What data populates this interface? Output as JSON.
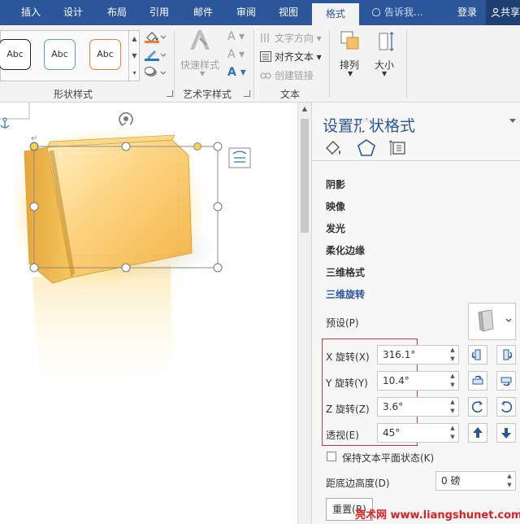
{
  "tabs": [
    "插入",
    "设计",
    "布局",
    "引用",
    "邮件",
    "审阅",
    "视图",
    "格式"
  ],
  "active_tab": "格式",
  "tell_me": "告诉我...",
  "sign_in": "登录",
  "share": "共享",
  "ribbon": {
    "style_samples": [
      "Abc",
      "Abc",
      "Abc"
    ],
    "style_colors": [
      "#222222",
      "#5b9bd5",
      "#ed7d31"
    ],
    "group_shape_styles": "形状样式",
    "quick_styles": "快速样式",
    "group_wordart": "艺术字样式",
    "text_direction": "文字方向",
    "align_text": "对齐文本",
    "create_link": "创建链接",
    "group_text": "文本",
    "arrange": "排列",
    "size": "大小"
  },
  "pane": {
    "title": "设置形状格式",
    "sections": [
      "阴影",
      "映像",
      "发光",
      "柔化边缘",
      "三维格式",
      "三维旋转"
    ],
    "active_section": "三维旋转",
    "preset_label": "预设(P)",
    "rotation": [
      {
        "label": "X 旋转(X)",
        "value": "316.1°"
      },
      {
        "label": "Y 旋转(Y)",
        "value": "10.4°"
      },
      {
        "label": "Z 旋转(Z)",
        "value": "3.6°"
      },
      {
        "label": "透视(E)",
        "value": "45°"
      }
    ],
    "keep_text_flat": "保持文本平面状态(K)",
    "distance_label": "距底边高度(D)",
    "distance_value": "0 磅",
    "reset": "重置(R)"
  },
  "watermark": "亮术网 www.liangshunet.com",
  "accent": "#2b579a",
  "highlight": "#d9363e"
}
